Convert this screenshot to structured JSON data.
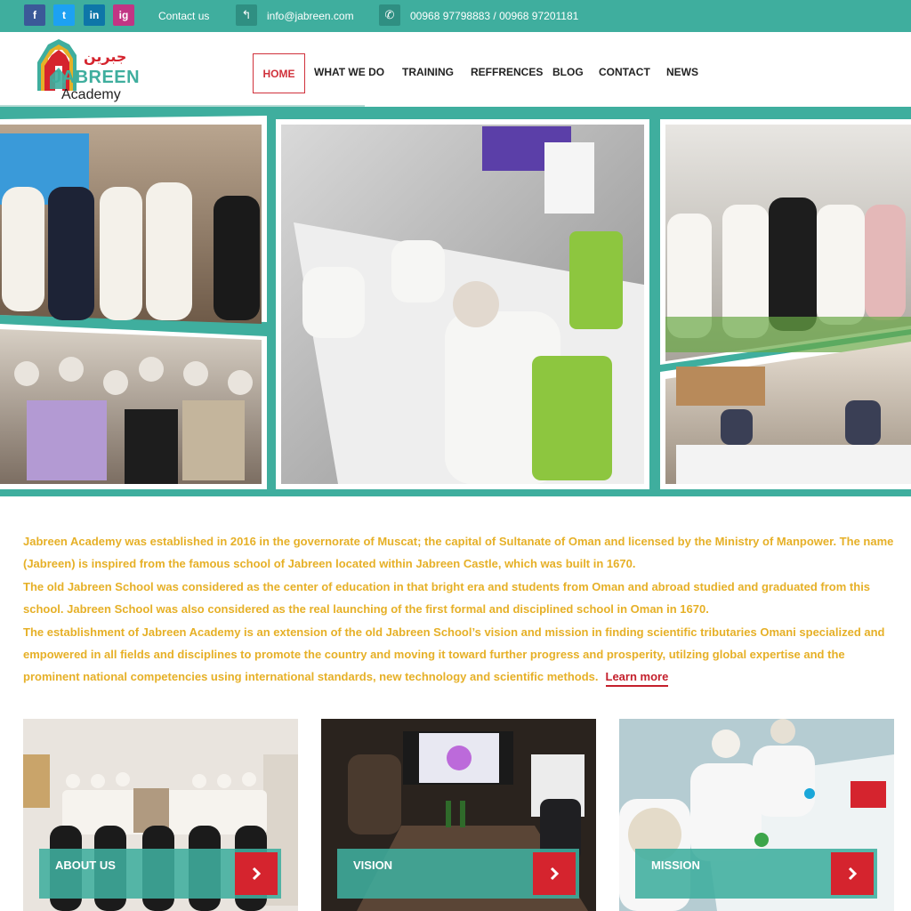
{
  "topbar": {
    "social": {
      "facebook": "f",
      "twitter": "t",
      "linkedin": "in",
      "instagram": "ig"
    },
    "contact_label": "Contact us",
    "email": "info@jabreen.com",
    "phones": "00968 97798883 / 00968 97201181",
    "icons": {
      "email": "reply-arrow-icon",
      "phone": "phone-icon"
    }
  },
  "logo": {
    "arabic": "جبرين",
    "name": "JABREEN",
    "sub": "Academy"
  },
  "nav": {
    "items": [
      "HOME",
      "WHAT WE DO",
      "TRAINING",
      "REFFRENCES",
      "BLOG",
      "CONTACT",
      "NEWS"
    ],
    "active": "HOME"
  },
  "about": {
    "p1": "Jabreen Academy was established in 2016 in the governorate of Muscat; the capital of Sultanate of Oman and licensed by the Ministry of Manpower. The name (Jabreen) is inspired from the famous school of Jabreen located within Jabreen Castle, which was built in 1670.",
    "p2": "The old Jabreen School was considered as the center of education in that bright era and students from Oman and abroad studied and graduated from this school. Jabreen School was also considered as the real launching of the first formal and disciplined school in Oman in 1670.",
    "p3": "The establishment of Jabreen Academy is an extension of the old Jabreen School’s vision and mission in finding scientific tributaries Omani specialized and empowered in all fields and disciplines to promote the country and moving it toward further progress and prosperity, utilzing global expertise and the prominent national competencies using international standards, new technology and scientific methods.",
    "learn_more": "Learn more"
  },
  "cards": [
    {
      "label": "ABOUT US"
    },
    {
      "label": "VISION"
    },
    {
      "label": "MISSION"
    }
  ],
  "colors": {
    "teal": "#3fae9e",
    "red": "#d5242e",
    "gold": "#e6b027"
  }
}
